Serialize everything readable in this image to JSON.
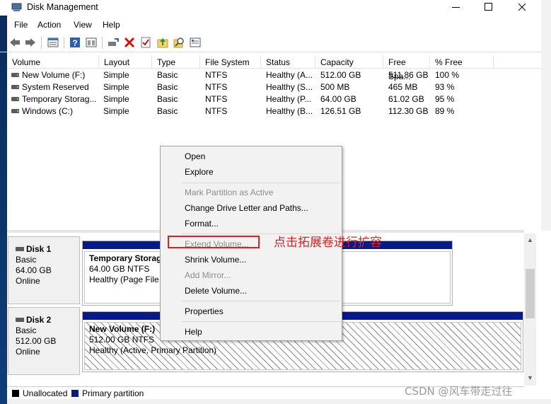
{
  "window": {
    "title": "Disk Management",
    "controls": {
      "minimize": "",
      "maximize": "",
      "close": ""
    }
  },
  "menubar": [
    "File",
    "Action",
    "View",
    "Help"
  ],
  "toolbar": {
    "icons": [
      "back-arrow-icon",
      "forward-arrow-icon",
      "properties-list-icon",
      "help-icon",
      "show-hide-icon",
      "connect-drive-icon",
      "delete-icon",
      "checklist-icon",
      "up-folder-icon",
      "search-icon",
      "settings-icon"
    ]
  },
  "volume_list": {
    "columns": [
      "Volume",
      "Layout",
      "Type",
      "File System",
      "Status",
      "Capacity",
      "Free Spa...",
      "% Free"
    ],
    "rows": [
      [
        "New Volume (F:)",
        "Simple",
        "Basic",
        "NTFS",
        "Healthy (A...",
        "512.00 GB",
        "511.86 GB",
        "100 %"
      ],
      [
        "System Reserved",
        "Simple",
        "Basic",
        "NTFS",
        "Healthy (S...",
        "500 MB",
        "465 MB",
        "93 %"
      ],
      [
        "Temporary Storag...",
        "Simple",
        "Basic",
        "NTFS",
        "Healthy (P...",
        "64.00 GB",
        "61.02 GB",
        "95 %"
      ],
      [
        "Windows (C:)",
        "Simple",
        "Basic",
        "NTFS",
        "Healthy (B...",
        "126.51 GB",
        "112.30 GB",
        "89 %"
      ]
    ]
  },
  "disks": [
    {
      "name": "Disk 1",
      "type": "Basic",
      "size": "64.00 GB",
      "state": "Online",
      "partition": {
        "title": "Temporary Storage",
        "line1": "64.00 GB NTFS",
        "line2": "Healthy (Page File, I"
      }
    },
    {
      "name": "Disk 2",
      "type": "Basic",
      "size": "512.00 GB",
      "state": "Online",
      "partition": {
        "title": "New Volume  (F:)",
        "line1": "512.00 GB NTFS",
        "line2": "Healthy (Active, Primary Partition)"
      }
    }
  ],
  "legend": {
    "unallocated": "Unallocated",
    "primary": "Primary partition",
    "unallocated_color": "#000000",
    "primary_color": "#061a8a"
  },
  "context_menu": {
    "open": "Open",
    "explore": "Explore",
    "mark_active": "Mark Partition as Active",
    "change_letter": "Change Drive Letter and Paths...",
    "format": "Format...",
    "extend": "Extend Volume...",
    "shrink": "Shrink Volume...",
    "add_mirror": "Add Mirror...",
    "delete": "Delete Volume...",
    "properties": "Properties",
    "help": "Help"
  },
  "annotation": "点击拓展卷进行扩容",
  "watermark": "CSDN @风车带走过往",
  "colors": {
    "highlight": "#e02020",
    "partition_stripe": "#061a8a"
  }
}
